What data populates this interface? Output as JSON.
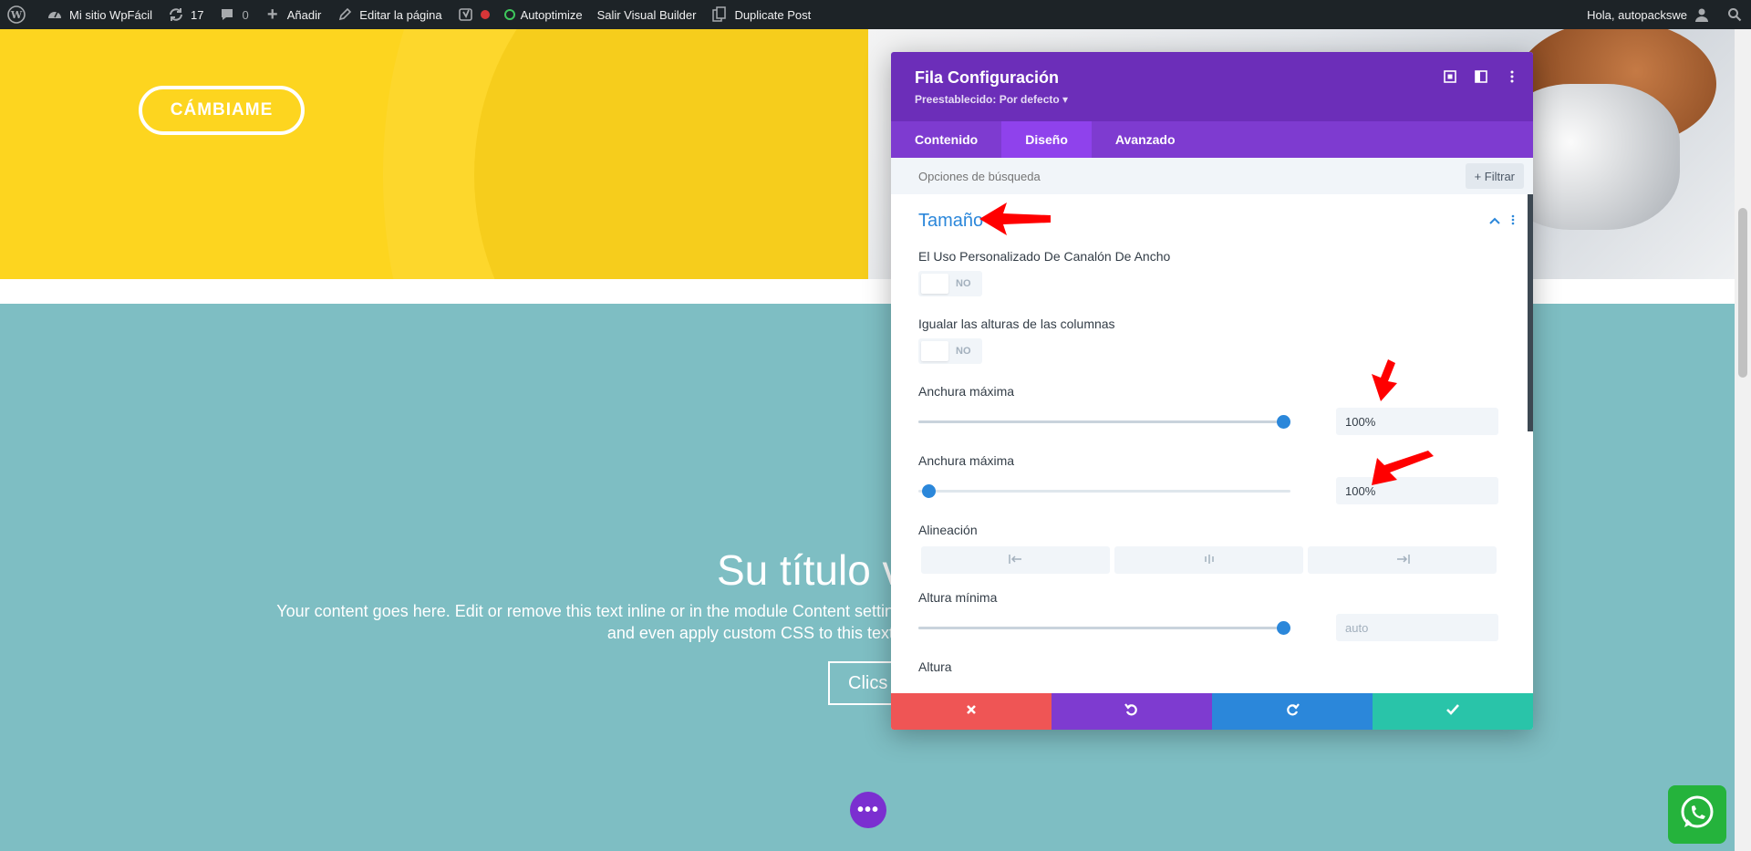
{
  "adminbar": {
    "site_name": "Mi sitio WpFácil",
    "updates_count": "17",
    "comments_count": "0",
    "add_label": "Añadir",
    "edit_label": "Editar la página",
    "autoptimize_label": "Autoptimize",
    "exit_vb_label": "Salir Visual Builder",
    "duplicate_label": "Duplicate Post",
    "greeting": "Hola, autopackswe"
  },
  "page": {
    "cta_label": "CÁMBIAME",
    "heading": "Su título v",
    "body_line1": "Your content goes here. Edit or remove this text inline or in the module Content settin",
    "body_line2": "and even apply custom CSS to this text",
    "button_label": "Clics",
    "dots_label": "•••"
  },
  "modal": {
    "title": "Fila Configuración",
    "preset": "Preestablecido: Por defecto ▾",
    "tabs": [
      {
        "label": "Contenido"
      },
      {
        "label": "Diseño"
      },
      {
        "label": "Avanzado"
      }
    ],
    "active_tab": "Diseño",
    "search_placeholder": "Opciones de búsqueda",
    "filter_label": "+ Filtrar",
    "section_title": "Tamaño",
    "fields": {
      "gutter_label": "El Uso Personalizado De Canalón De Ancho",
      "gutter_toggle": "NO",
      "equal_heights_label": "Igualar las alturas de las columnas",
      "equal_heights_toggle": "NO",
      "max_width_1_label": "Anchura máxima",
      "max_width_1_value": "100%",
      "max_width_1_slider": 1.0,
      "max_width_2_label": "Anchura máxima",
      "max_width_2_value": "100%",
      "max_width_2_slider": 0.0,
      "alignment_label": "Alineación",
      "min_height_label": "Altura mínima",
      "min_height_placeholder": "auto",
      "min_height_slider": 1.0,
      "height_label": "Altura"
    }
  },
  "colors": {
    "admin_bar": "#1d2327",
    "hero_yellow": "#fdd51f",
    "teal_section": "#7ebec3",
    "modal_header": "#6c2eb9",
    "modal_tabs": "#7e3bd0",
    "accent_blue": "#2b87da",
    "cancel_red": "#ef5555",
    "undo_purple": "#7e3bd0",
    "redo_blue": "#2b87da",
    "save_green": "#29c4a9",
    "whatsapp_green": "#25b33c",
    "annotation_red": "#ff0000"
  }
}
